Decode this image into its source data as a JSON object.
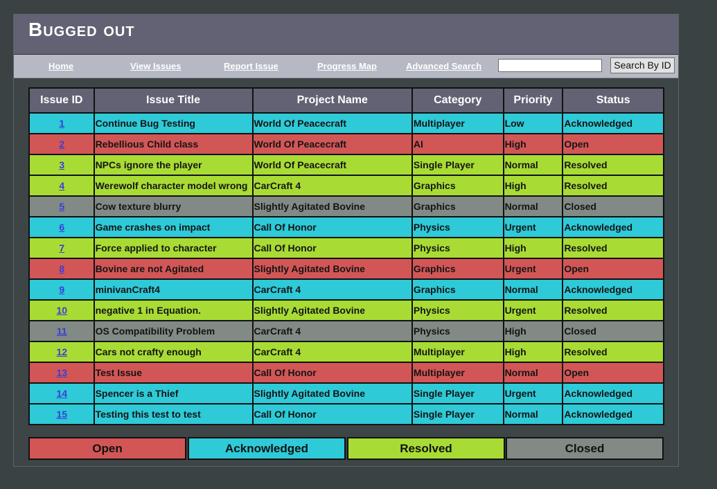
{
  "app": {
    "title": "Bugged out"
  },
  "nav": {
    "home": "Home",
    "view_issues": "View Issues",
    "report_issue": "Report Issue",
    "progress_map": "Progress Map",
    "advanced_search": "Advanced Search",
    "search_value": "",
    "search_button": "Search By ID"
  },
  "colors": {
    "Open": "#d35656",
    "Acknowledged": "#2ecad8",
    "Resolved": "#a8dc34",
    "Closed": "#818a84"
  },
  "table": {
    "columns": [
      "Issue ID",
      "Issue Title",
      "Project Name",
      "Category",
      "Priority",
      "Status"
    ],
    "rows": [
      {
        "id": "1",
        "title": "Continue Bug Testing",
        "project": "World Of Peacecraft",
        "category": "Multiplayer",
        "priority": "Low",
        "status": "Acknowledged"
      },
      {
        "id": "2",
        "title": "Rebellious Child class",
        "project": "World Of Peacecraft",
        "category": "AI",
        "priority": "High",
        "status": "Open"
      },
      {
        "id": "3",
        "title": "NPCs ignore the player",
        "project": "World Of Peacecraft",
        "category": "Single Player",
        "priority": "Normal",
        "status": "Resolved"
      },
      {
        "id": "4",
        "title": "Werewolf character model wrong",
        "project": "CarCraft 4",
        "category": "Graphics",
        "priority": "High",
        "status": "Resolved"
      },
      {
        "id": "5",
        "title": "Cow texture blurry",
        "project": "Slightly Agitated Bovine",
        "category": "Graphics",
        "priority": "Normal",
        "status": "Closed"
      },
      {
        "id": "6",
        "title": "Game crashes on impact",
        "project": "Call Of Honor",
        "category": "Physics",
        "priority": "Urgent",
        "status": "Acknowledged"
      },
      {
        "id": "7",
        "title": "Force applied to character",
        "project": "Call Of Honor",
        "category": "Physics",
        "priority": "High",
        "status": "Resolved"
      },
      {
        "id": "8",
        "title": "Bovine are not Agitated",
        "project": "Slightly Agitated Bovine",
        "category": "Graphics",
        "priority": "Urgent",
        "status": "Open"
      },
      {
        "id": "9",
        "title": "minivanCraft4",
        "project": "CarCraft 4",
        "category": "Graphics",
        "priority": "Normal",
        "status": "Acknowledged"
      },
      {
        "id": "10",
        "title": "negative 1 in Equation.",
        "project": "Slightly Agitated Bovine",
        "category": "Physics",
        "priority": "Urgent",
        "status": "Resolved"
      },
      {
        "id": "11",
        "title": "OS Compatibility Problem",
        "project": "CarCraft 4",
        "category": "Physics",
        "priority": "High",
        "status": "Closed"
      },
      {
        "id": "12",
        "title": "Cars not crafty enough",
        "project": "CarCraft 4",
        "category": "Multiplayer",
        "priority": "High",
        "status": "Resolved"
      },
      {
        "id": "13",
        "title": "Test Issue",
        "project": "Call Of Honor",
        "category": "Multiplayer",
        "priority": "Normal",
        "status": "Open"
      },
      {
        "id": "14",
        "title": "Spencer is a Thief",
        "project": "Slightly Agitated Bovine",
        "category": "Single Player",
        "priority": "Urgent",
        "status": "Acknowledged"
      },
      {
        "id": "15",
        "title": "Testing this test to test",
        "project": "Call Of Honor",
        "category": "Single Player",
        "priority": "Normal",
        "status": "Acknowledged"
      }
    ]
  },
  "legend": [
    "Open",
    "Acknowledged",
    "Resolved",
    "Closed"
  ]
}
